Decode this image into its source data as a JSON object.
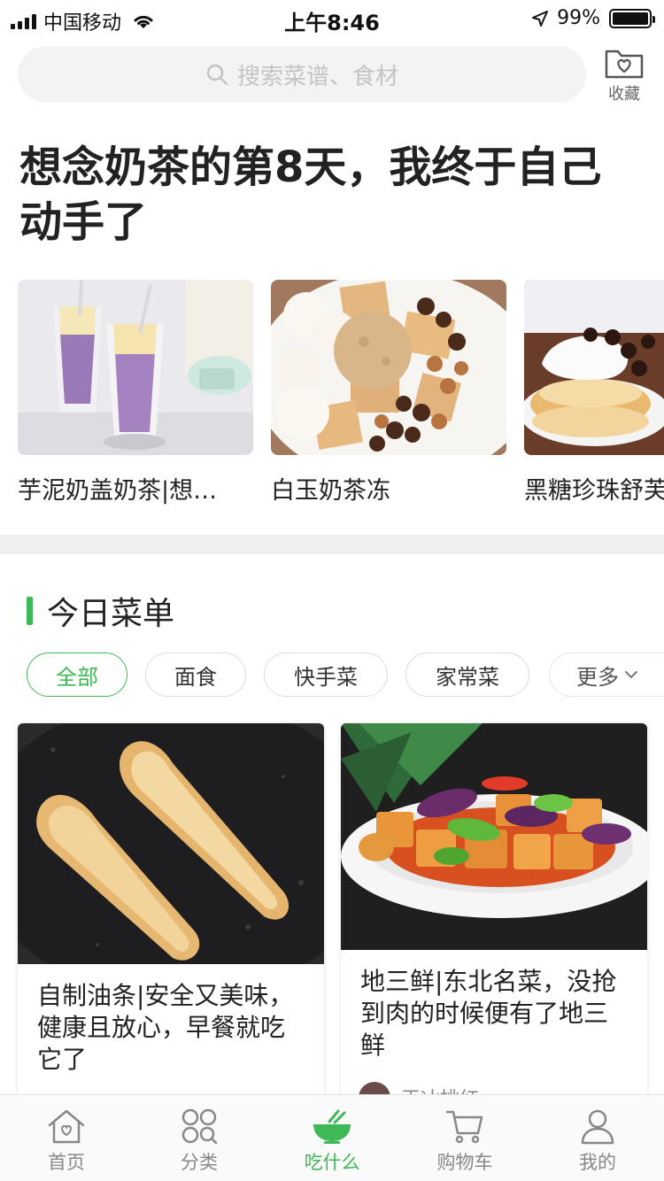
{
  "status_bar": {
    "carrier": "中国移动",
    "time": "上午8:46",
    "battery": "99%",
    "battery_level": 0.99
  },
  "search": {
    "placeholder": "搜索菜谱、食材"
  },
  "favorites": {
    "label": "收藏"
  },
  "headline": "想念奶茶的第8天，我终于自己动手了",
  "featured_recipes": [
    {
      "title": "芋泥奶盖奶茶|想…"
    },
    {
      "title": "白玉奶茶冻"
    },
    {
      "title": "黑糖珍珠舒芙蕾"
    }
  ],
  "today_menu": {
    "title": "今日菜单",
    "filters": [
      "全部",
      "面食",
      "快手菜",
      "家常菜"
    ],
    "active_filter": "全部",
    "more_label": "更多"
  },
  "feed": [
    {
      "title": "自制油条|安全又美味，健康且放心，早餐就吃它了"
    },
    {
      "title": "地三鲜|东北名菜，没抢到肉的时候便有了地三鲜",
      "author": "王冰桃红"
    }
  ],
  "tab_bar": {
    "items": [
      {
        "label": "首页",
        "icon": "home-icon"
      },
      {
        "label": "分类",
        "icon": "category-icon"
      },
      {
        "label": "吃什么",
        "icon": "bowl-icon"
      },
      {
        "label": "购物车",
        "icon": "cart-icon"
      },
      {
        "label": "我的",
        "icon": "profile-icon"
      }
    ],
    "active": "吃什么"
  },
  "colors": {
    "accent": "#3fb957",
    "search_bg": "#f3f3f3",
    "section_gap": "#efefef"
  }
}
